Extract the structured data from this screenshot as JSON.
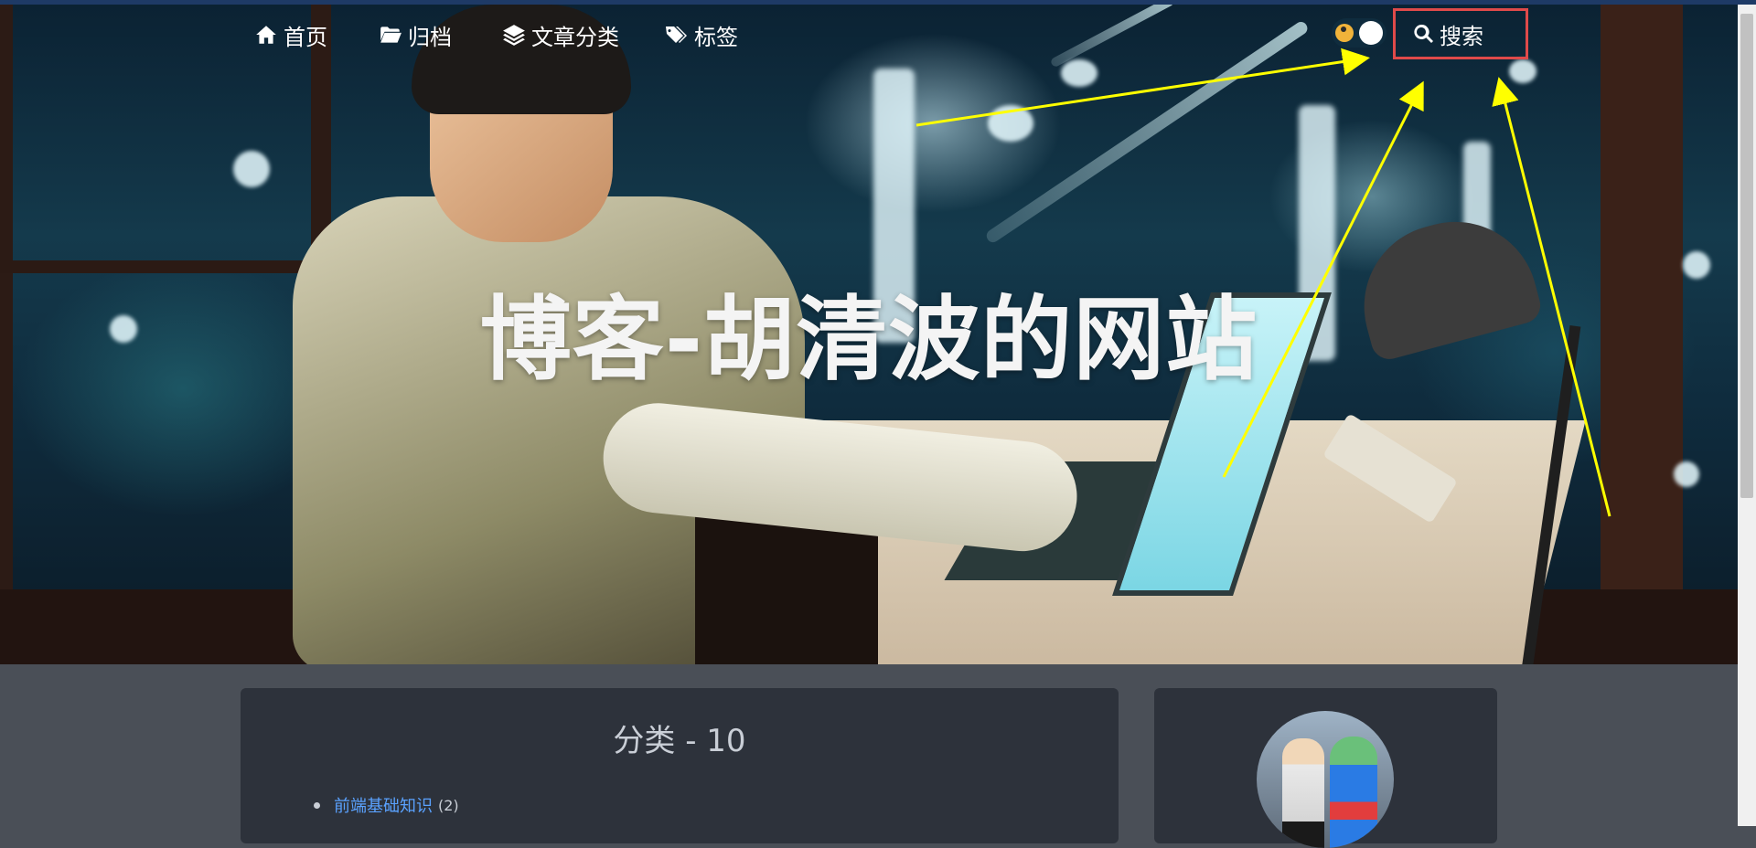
{
  "nav": {
    "home": "首页",
    "archive": "归档",
    "categories": "文章分类",
    "tags": "标签",
    "search": "搜索"
  },
  "hero": {
    "title": "博客-胡清波的网站"
  },
  "categories_card": {
    "title": "分类 - 10",
    "items": [
      {
        "name": "前端基础知识",
        "count": "(2)"
      }
    ]
  },
  "colors": {
    "annotation_arrow": "#ffff00",
    "search_highlight": "#e04a4a",
    "link": "#5aa2ff",
    "card_bg": "#2d323b",
    "page_bg": "#4a4f57"
  },
  "icons": [
    "home-icon",
    "folder-open-icon",
    "layers-icon",
    "tags-icon",
    "search-icon",
    "sun-icon",
    "moon-icon"
  ]
}
